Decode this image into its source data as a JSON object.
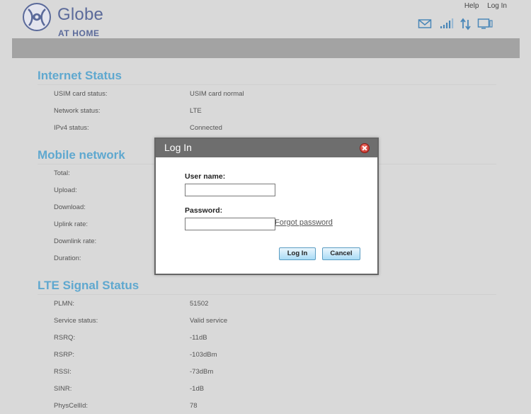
{
  "brand": {
    "name": "Globe",
    "subtitle": "AT HOME"
  },
  "top_links": {
    "help": "Help",
    "login": "Log In"
  },
  "colors": {
    "section_title": "#5fa8cf",
    "brand": "#5b6a9a",
    "banner": "#a3a3a3",
    "dialog_titlebar": "#6e6e6e"
  },
  "status_icons": [
    "mail-icon",
    "signal-strength-icon",
    "data-transfer-icon",
    "connected-device-icon"
  ],
  "internet_status": {
    "title": "Internet Status",
    "rows": [
      {
        "label": "USIM card status:",
        "value": "USIM card normal"
      },
      {
        "label": "Network status:",
        "value": "LTE"
      },
      {
        "label": "IPv4 status:",
        "value": "Connected"
      }
    ]
  },
  "mobile_network": {
    "title": "Mobile network",
    "rows": [
      {
        "label": "Total:",
        "value": ""
      },
      {
        "label": "Upload:",
        "value": ""
      },
      {
        "label": "Download:",
        "value": ""
      },
      {
        "label": "Uplink rate:",
        "value": ""
      },
      {
        "label": "Downlink rate:",
        "value": ""
      },
      {
        "label": "Duration:",
        "value": ""
      }
    ]
  },
  "lte_signal": {
    "title": "LTE Signal Status",
    "rows": [
      {
        "label": "PLMN:",
        "value": "51502"
      },
      {
        "label": "Service status:",
        "value": "Valid service"
      },
      {
        "label": "RSRQ:",
        "value": "-11dB"
      },
      {
        "label": "RSRP:",
        "value": "-103dBm"
      },
      {
        "label": "RSSI:",
        "value": "-73dBm"
      },
      {
        "label": "SINR:",
        "value": "-1dB"
      },
      {
        "label": "PhysCellId:",
        "value": "78"
      }
    ]
  },
  "login_dialog": {
    "title": "Log In",
    "username_label": "User name:",
    "username_value": "",
    "password_label": "Password:",
    "password_value": "",
    "forgot_password": "Forgot password",
    "login_button": "Log In",
    "cancel_button": "Cancel"
  }
}
